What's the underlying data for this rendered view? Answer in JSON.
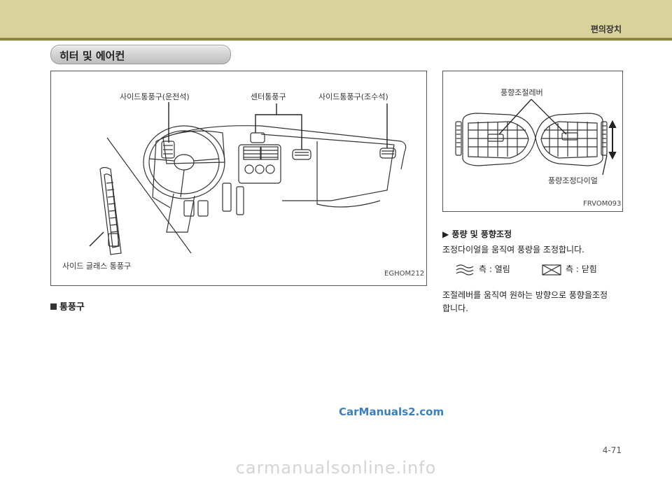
{
  "header": {
    "chapter_title": "편의장치"
  },
  "section": {
    "title": "히터 및 에어컨"
  },
  "figure1": {
    "label_side_driver": "사이드통풍구(운전석)",
    "label_center": "센터통풍구",
    "label_side_passenger": "사이드통풍구(조수석)",
    "label_side_glass": "사이드 글래스 통풍구",
    "code": "EGHOM212"
  },
  "figure1_caption": "통풍구",
  "figure2": {
    "label_lever": "풍향조절레버",
    "label_dial": "풍량조정다이얼",
    "code": "FRVOM093"
  },
  "subsection": {
    "title": "▶ 풍량 및 풍향조정",
    "para1": "조정다이얼을 움직여 풍량을 조정합니다.",
    "open_text": "측 : 열림",
    "close_text": "측 : 닫힘",
    "para2_line1": "조절레버를 움직여 원하는 방향으로 풍향을조정",
    "para2_line2": "합니다."
  },
  "icons": {
    "open": "airflow-open-icon",
    "close": "airflow-closed-icon"
  },
  "page_number": "4-71",
  "watermark": "CarManuals2.com",
  "footer_watermark": "carmanualsonline.info"
}
